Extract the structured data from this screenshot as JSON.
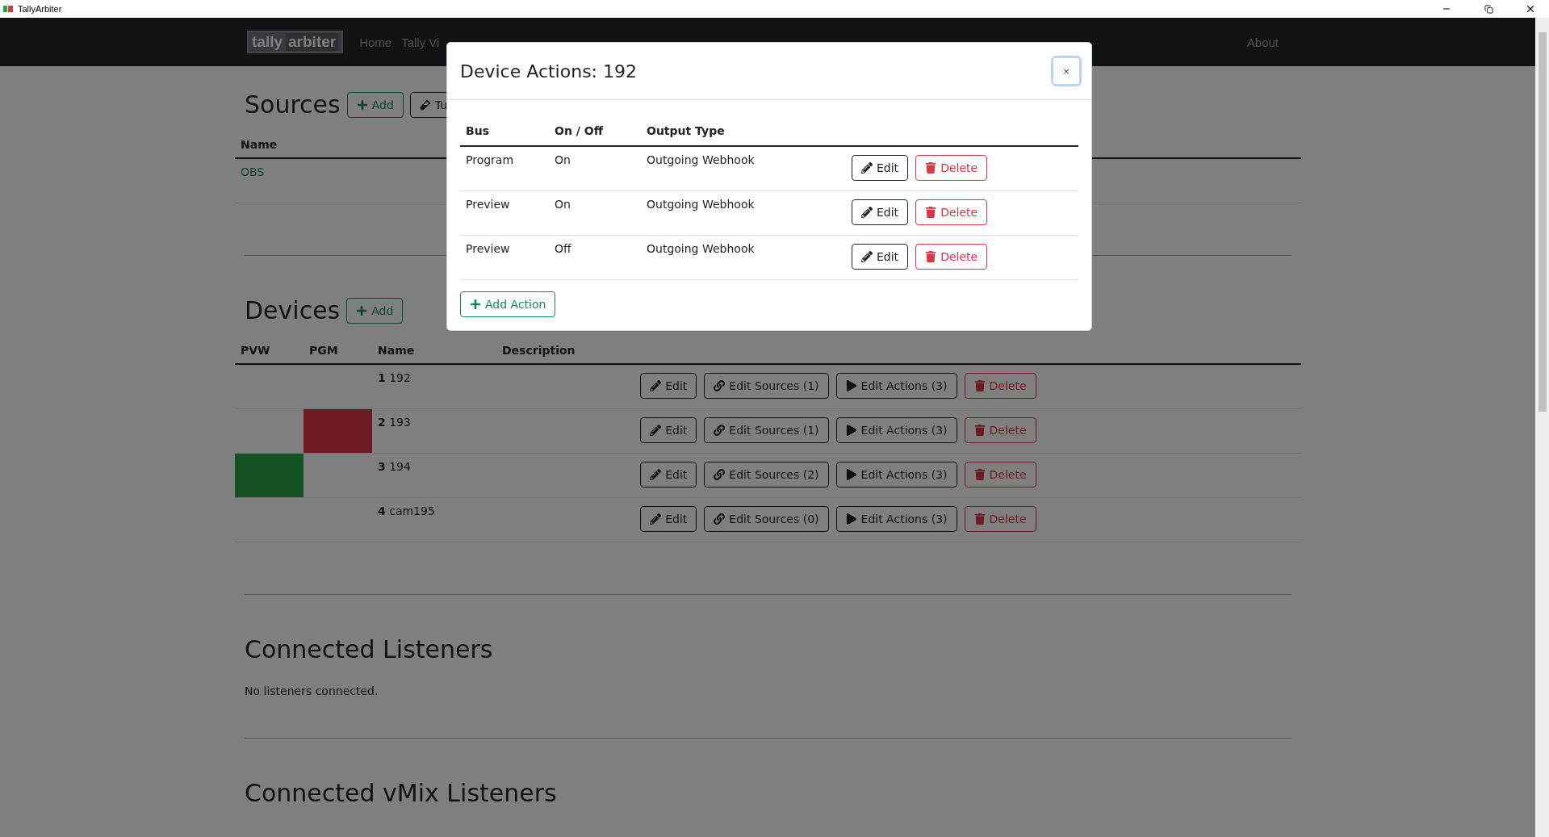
{
  "window": {
    "title": "TallyArbiter"
  },
  "navbar": {
    "logo": [
      "tally",
      "arbiter"
    ],
    "links": [
      "Home",
      "Tally Vi"
    ],
    "right_link": "About"
  },
  "sources": {
    "title": "Sources",
    "add_button": "Add",
    "test_button": "Tu",
    "columns": [
      "Name"
    ],
    "rows": [
      {
        "name": "OBS"
      }
    ]
  },
  "devices": {
    "title": "Devices",
    "add_button": "Add",
    "columns": [
      "PVW",
      "PGM",
      "Name",
      "Description"
    ],
    "rows": [
      {
        "number": "1",
        "name": "192",
        "pvw": false,
        "pgm": false,
        "buttons": [
          "Edit",
          "Edit Sources (1)",
          "Edit Actions (3)",
          "Delete"
        ]
      },
      {
        "number": "2",
        "name": "193",
        "pvw": false,
        "pgm": true,
        "buttons": [
          "Edit",
          "Edit Sources (1)",
          "Edit Actions (3)",
          "Delete"
        ]
      },
      {
        "number": "3",
        "name": "194",
        "pvw": true,
        "pgm": false,
        "buttons": [
          "Edit",
          "Edit Sources (2)",
          "Edit Actions (3)",
          "Delete"
        ]
      },
      {
        "number": "4",
        "name": "cam195",
        "pvw": false,
        "pgm": false,
        "buttons": [
          "Edit",
          "Edit Sources (0)",
          "Edit Actions (3)",
          "Delete"
        ]
      }
    ]
  },
  "listeners": {
    "title": "Connected Listeners",
    "empty_text": "No listeners connected."
  },
  "vmix_listeners": {
    "title": "Connected vMix Listeners"
  },
  "modal": {
    "title": "Device Actions: 192",
    "close": "×",
    "columns": [
      "Bus",
      "On / Off",
      "Output Type"
    ],
    "rows": [
      {
        "bus": "Program",
        "state": "On",
        "output_type": "Outgoing Webhook",
        "buttons": [
          "Edit",
          "Delete"
        ]
      },
      {
        "bus": "Preview",
        "state": "On",
        "output_type": "Outgoing Webhook",
        "buttons": [
          "Edit",
          "Delete"
        ]
      },
      {
        "bus": "Preview",
        "state": "Off",
        "output_type": "Outgoing Webhook",
        "buttons": [
          "Edit",
          "Delete"
        ]
      }
    ],
    "add_button": "Add Action"
  }
}
